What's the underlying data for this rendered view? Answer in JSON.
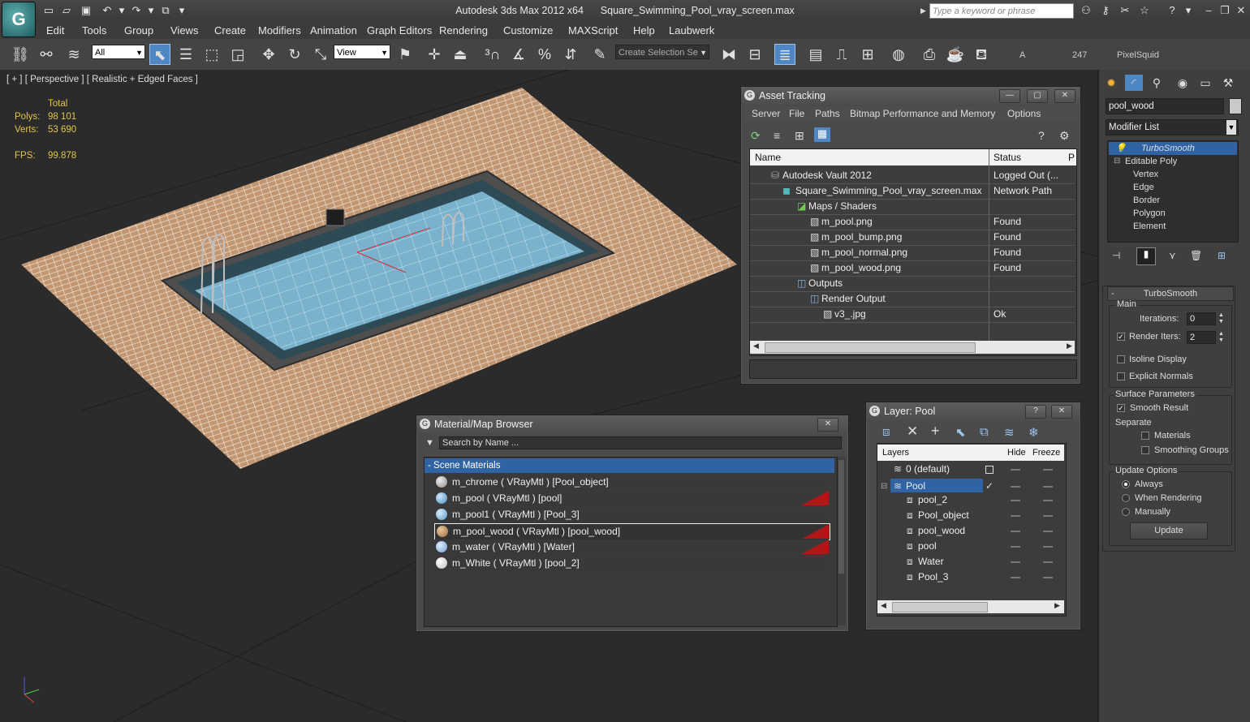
{
  "title": {
    "app": "Autodesk 3ds Max  2012 x64",
    "file": "Square_Swimming_Pool_vray_screen.max",
    "search_placeholder": "Type a keyword or phrase"
  },
  "menu": [
    "Edit",
    "Tools",
    "Group",
    "Views",
    "Create",
    "Modifiers",
    "Animation",
    "Graph Editors",
    "Rendering",
    "Customize",
    "MAXScript",
    "Help",
    "Laubwerk"
  ],
  "toolbar": {
    "filter_value": "All",
    "refcoord_value": "View",
    "selection_set_placeholder": "Create Selection Se",
    "label_a": "A",
    "count": "247",
    "plugin": "PixelSquid"
  },
  "viewport": {
    "label": "[ + ] [ Perspective ] [ Realistic + Edged Faces ]",
    "stats": {
      "total_label": "Total",
      "polys_label": "Polys:",
      "polys_value": "98 101",
      "verts_label": "Verts:",
      "verts_value": "53 690",
      "fps_label": "FPS:",
      "fps_value": "99.878"
    }
  },
  "asset_tracking": {
    "title": "Asset Tracking",
    "menu": [
      "Server",
      "File",
      "Paths",
      "Bitmap Performance and Memory",
      "Options"
    ],
    "columns": [
      "Name",
      "Status",
      "P"
    ],
    "rows": [
      {
        "name": "Autodesk Vault 2012",
        "status": "Logged Out (..."
      },
      {
        "name": "Square_Swimming_Pool_vray_screen.max",
        "status": "Network Path"
      },
      {
        "name": "Maps / Shaders",
        "status": ""
      },
      {
        "name": "m_pool.png",
        "status": "Found"
      },
      {
        "name": "m_pool_bump.png",
        "status": "Found"
      },
      {
        "name": "m_pool_normal.png",
        "status": "Found"
      },
      {
        "name": "m_pool_wood.png",
        "status": "Found"
      },
      {
        "name": "Outputs",
        "status": ""
      },
      {
        "name": "Render Output",
        "status": ""
      },
      {
        "name": "v3_.jpg",
        "status": "Ok"
      }
    ]
  },
  "material_browser": {
    "title": "Material/Map Browser",
    "search_placeholder": "Search by Name ...",
    "group": "- Scene Materials",
    "items": [
      {
        "label": "m_chrome  ( VRayMtl )  [Pool_object]",
        "color": "#8a8a8a"
      },
      {
        "label": "m_pool  ( VRayMtl )  [pool]",
        "color": "#4a8fc4"
      },
      {
        "label": "m_pool1  ( VRayMtl )  [Pool_3]",
        "color": "#5a9ccf"
      },
      {
        "label": "m_pool_wood  ( VRayMtl )  [pool_wood]",
        "color": "#a0703e"
      },
      {
        "label": "m_water  ( VRayMtl )  [Water]",
        "color": "#6f9ed8"
      },
      {
        "label": "m_White  ( VRayMtl )  [pool_2]",
        "color": "#bdbdbd"
      }
    ]
  },
  "layer_window": {
    "title": "Layer: Pool",
    "columns": [
      "Layers",
      "Hide",
      "Freeze"
    ],
    "rows": [
      {
        "name": "0 (default)"
      },
      {
        "name": "Pool"
      },
      {
        "name": "pool_2"
      },
      {
        "name": "Pool_object"
      },
      {
        "name": "pool_wood"
      },
      {
        "name": "pool"
      },
      {
        "name": "Water"
      },
      {
        "name": "Pool_3"
      }
    ]
  },
  "command_panel": {
    "object_name": "pool_wood",
    "modifier_list": "Modifier List",
    "stack": [
      "TurboSmooth",
      "Editable Poly",
      "Vertex",
      "Edge",
      "Border",
      "Polygon",
      "Element"
    ],
    "turbosmooth": {
      "header": "TurboSmooth",
      "main_label": "Main",
      "iterations_label": "Iterations:",
      "iterations_value": "0",
      "render_iters_label": "Render Iters:",
      "render_iters_value": "2",
      "isoline_label": "Isoline Display",
      "explicit_label": "Explicit Normals",
      "surface_label": "Surface Parameters",
      "smooth_result_label": "Smooth Result",
      "separate_label": "Separate",
      "materials_label": "Materials",
      "smoothing_groups_label": "Smoothing Groups",
      "update_options_label": "Update Options",
      "always_label": "Always",
      "when_rendering_label": "When Rendering",
      "manually_label": "Manually",
      "update_button": "Update"
    }
  }
}
